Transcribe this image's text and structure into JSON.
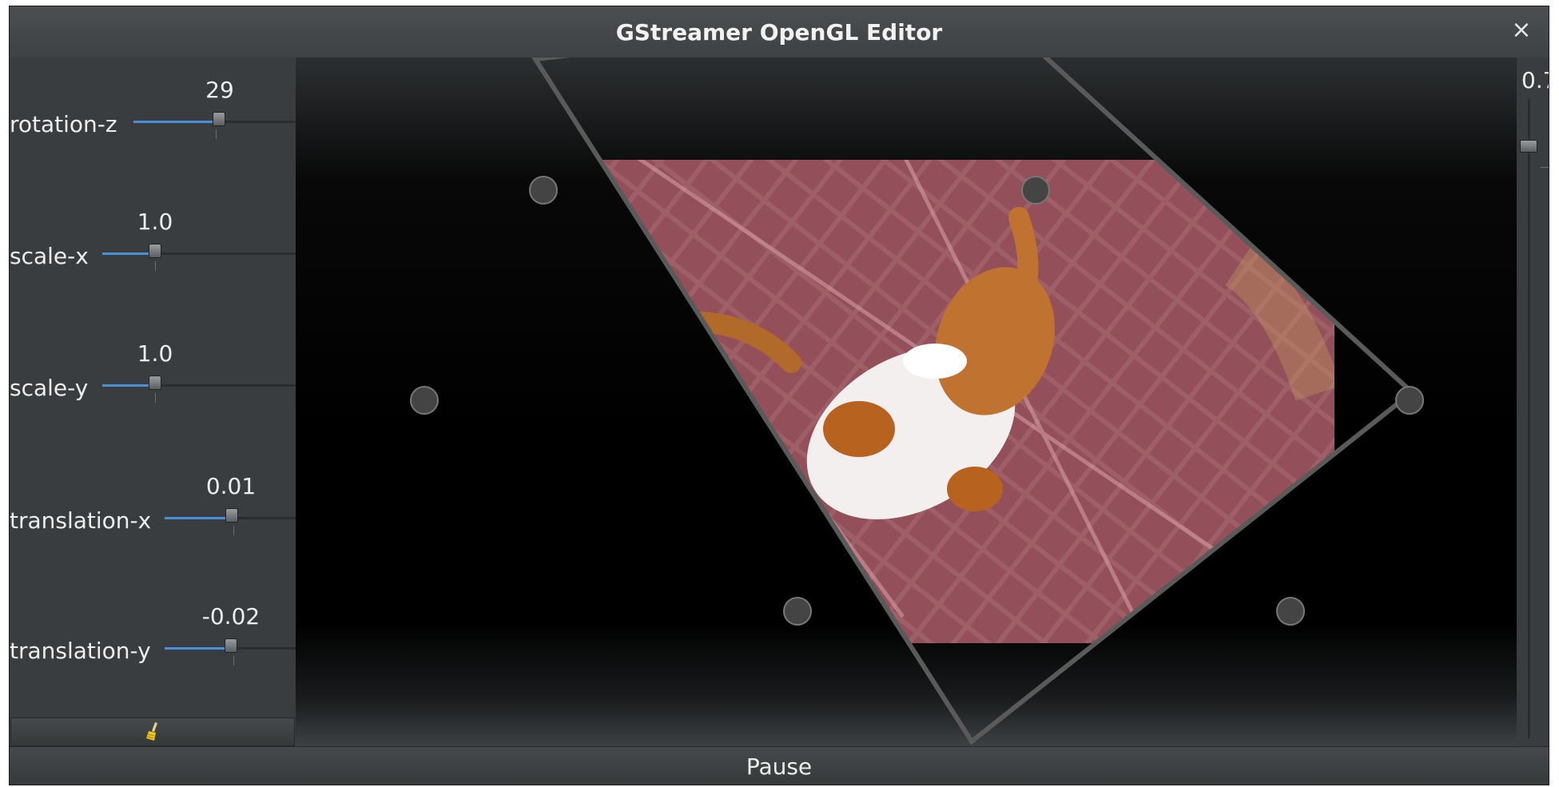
{
  "window": {
    "title": "GStreamer OpenGL Editor",
    "close_glyph": "×"
  },
  "params": [
    {
      "label": "rotation-z",
      "value": "29",
      "fraction": 0.5
    },
    {
      "label": "scale-x",
      "value": "1.0",
      "fraction": 0.25
    },
    {
      "label": "scale-y",
      "value": "1.0",
      "fraction": 0.25
    },
    {
      "label": "translation-x",
      "value": "0.01",
      "fraction": 0.5
    },
    {
      "label": "translation-y",
      "value": "-0.02",
      "fraction": 0.49
    }
  ],
  "reset_button": {
    "icon": "broom-icon"
  },
  "right_slider": {
    "value": "0.7"
  },
  "pause_button": {
    "label": "Pause"
  },
  "colors": {
    "accent": "#4a90d9",
    "background": "#3a3d3f",
    "viewer": "#000000"
  },
  "video_frame": {
    "icon": "cat-video-frame"
  }
}
